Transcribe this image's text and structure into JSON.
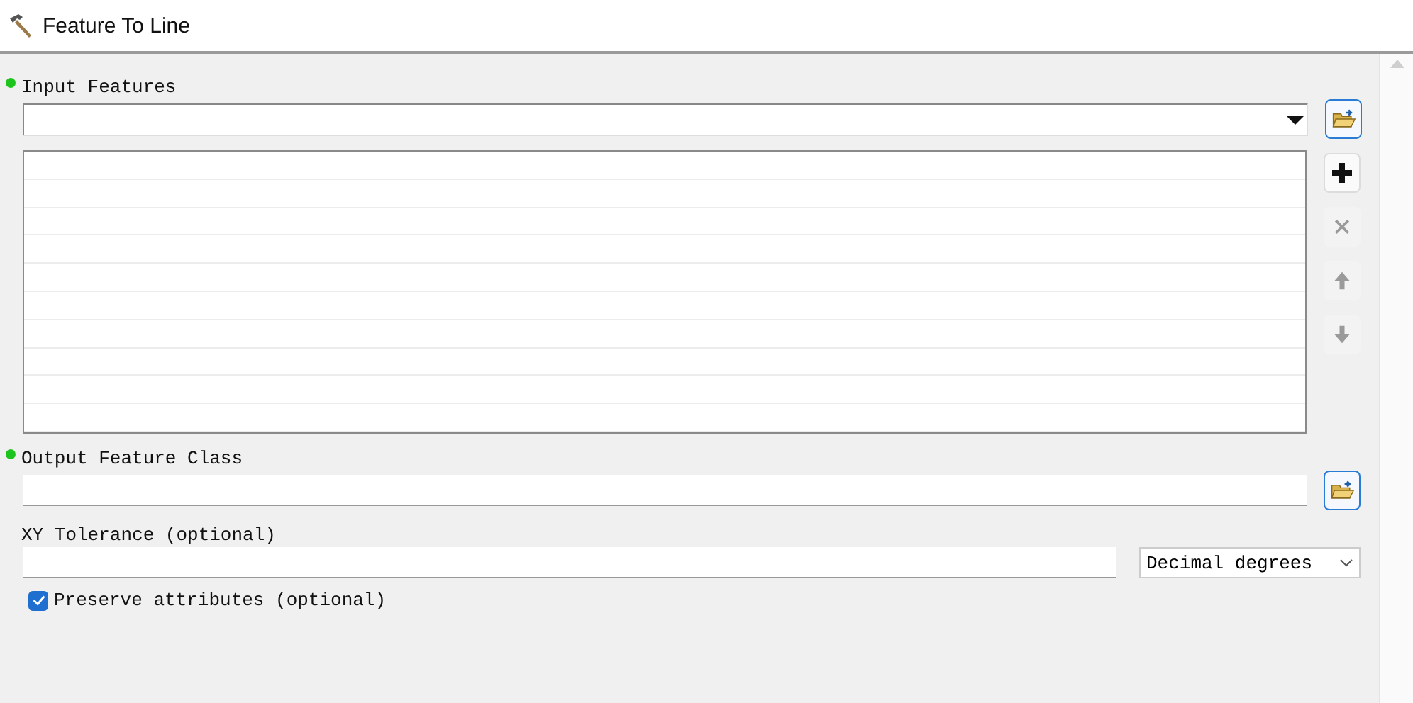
{
  "window": {
    "title": "Feature To Line"
  },
  "input_features": {
    "label": "Input Features",
    "required": true
  },
  "list_buttons": [
    {
      "kind": "add",
      "disabled": false
    },
    {
      "kind": "remove",
      "disabled": true
    },
    {
      "kind": "up",
      "disabled": true
    },
    {
      "kind": "down",
      "disabled": true
    }
  ],
  "output_feature_class": {
    "label": "Output Feature Class",
    "required": true
  },
  "xy_tolerance": {
    "label": "XY Tolerance (optional)",
    "unit": "Decimal degrees"
  },
  "preserve_attributes": {
    "label": "Preserve attributes (optional)",
    "checked": true
  }
}
